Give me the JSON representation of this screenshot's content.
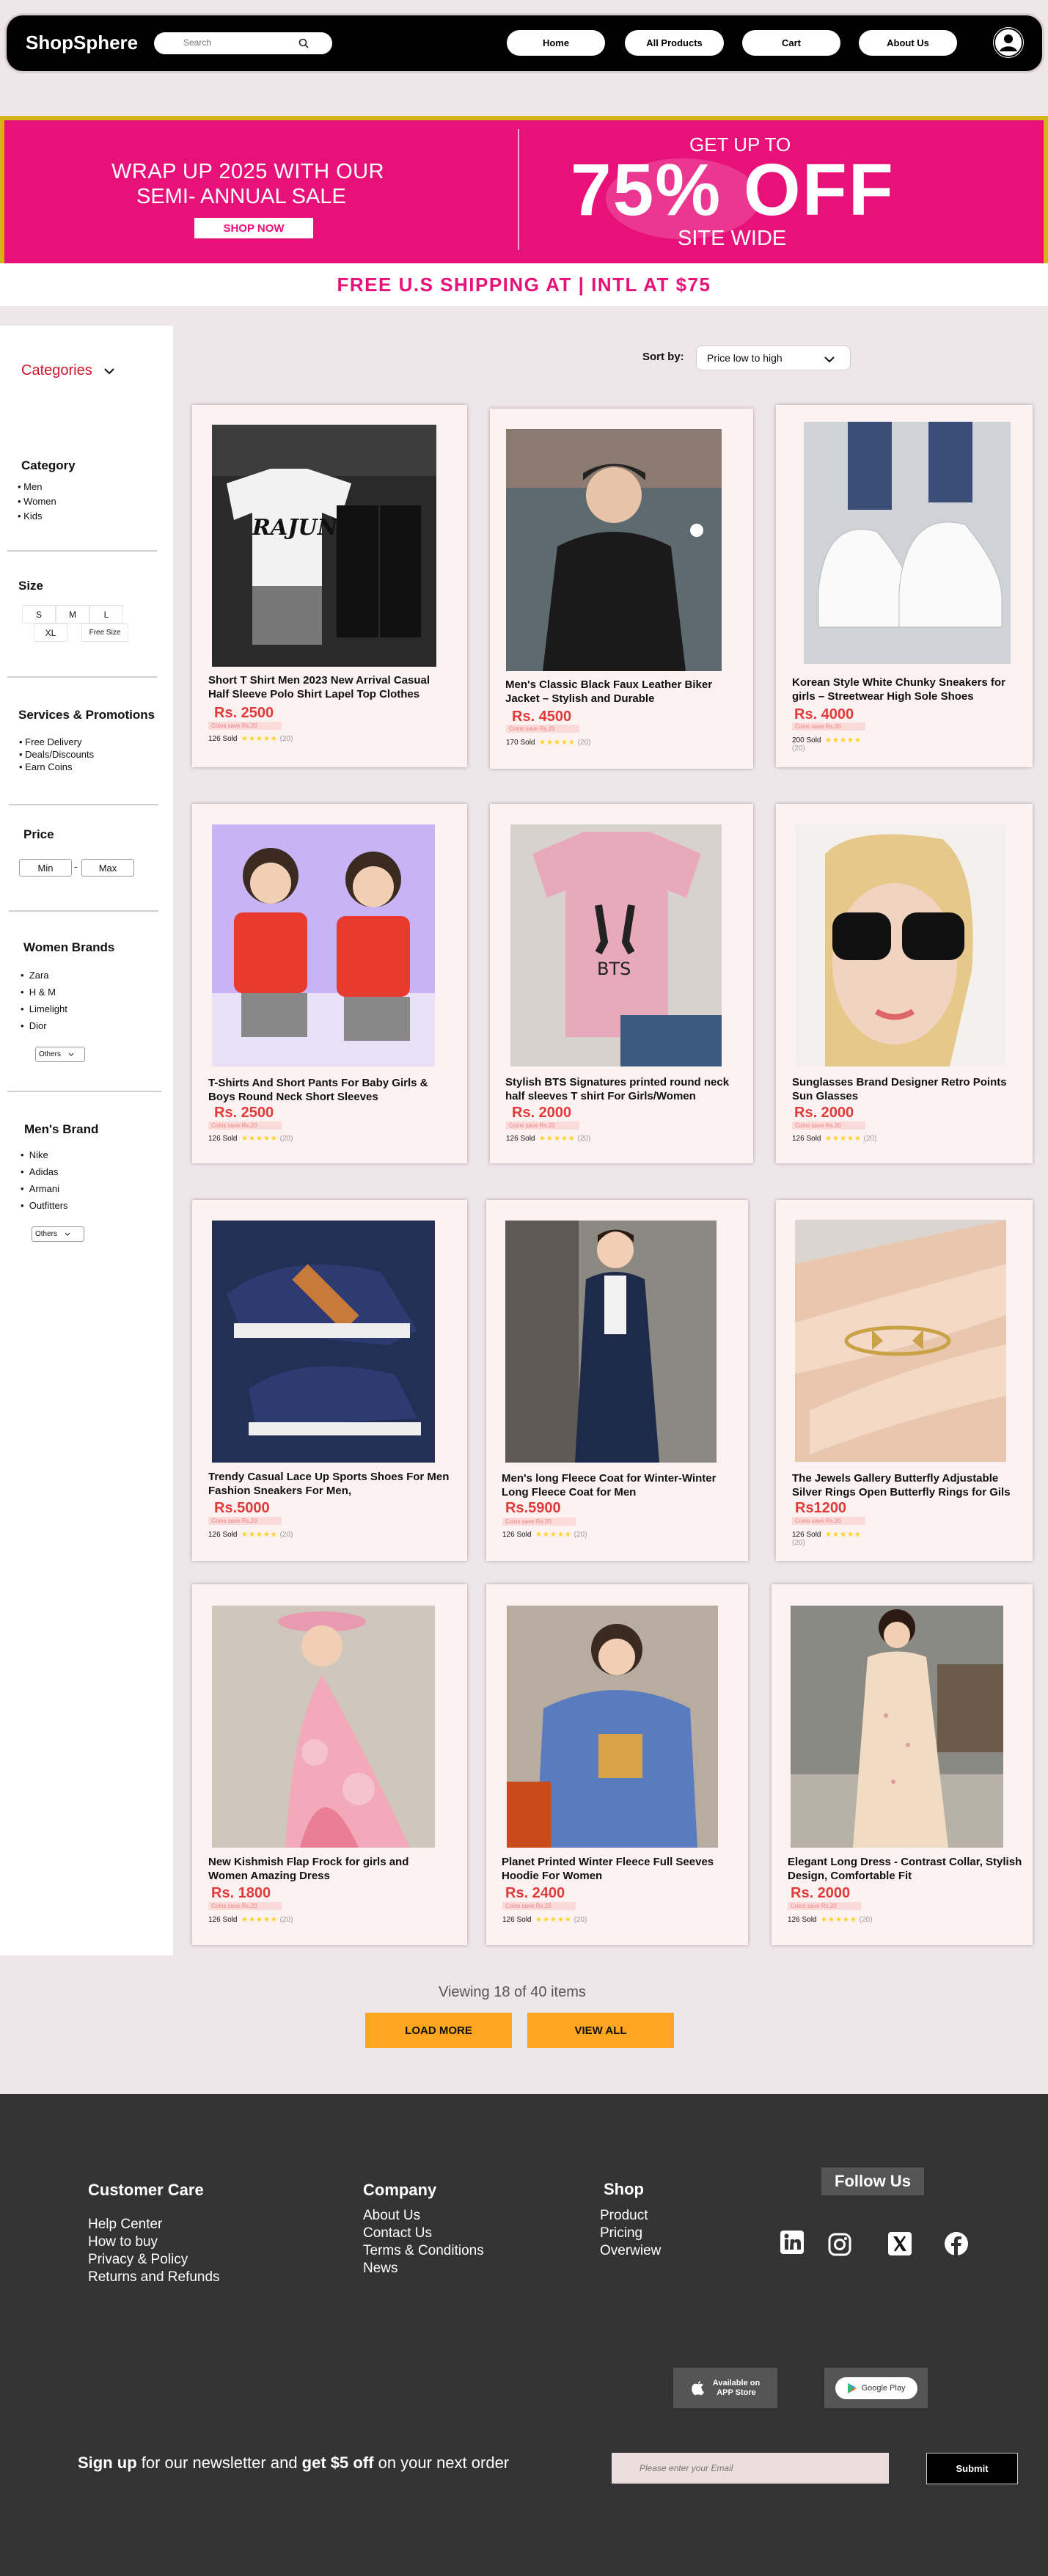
{
  "header": {
    "logo": "ShopSphere",
    "search_placeholder": "Search",
    "nav": [
      "Home",
      "All Products",
      "Cart",
      "About Us"
    ]
  },
  "banner": {
    "line1": "WRAP UP 2025 WITH OUR",
    "line2": "SEMI- ANNUAL SALE",
    "shop_now": "SHOP NOW",
    "get_up_to": "GET UP TO",
    "discount": "75%  OFF",
    "site_wide": "SITE WIDE"
  },
  "shipping": "FREE U.S SHIPPING AT  |  INTL  AT  $75",
  "sidebar": {
    "categories_title": "Categories",
    "category": {
      "title": "Category",
      "items": [
        "Men",
        "Women",
        "Kids"
      ]
    },
    "size": {
      "title": "Size",
      "options": [
        "S",
        "M",
        "L",
        "XL",
        "Free Size"
      ]
    },
    "services": {
      "title": "Services & Promotions",
      "items": [
        "Free Delivery",
        "Deals/Discounts",
        "Earn Coins"
      ]
    },
    "price": {
      "title": "Price",
      "min": "Min",
      "max": "Max",
      "separator": "-"
    },
    "women_brands": {
      "title": "Women Brands",
      "items": [
        "Zara",
        "H & M",
        "Limelight",
        "Dior"
      ],
      "others": "Others"
    },
    "men_brands": {
      "title": "Men's Brand",
      "items": [
        "Nike",
        "Adidas",
        "Armani",
        "Outfitters"
      ],
      "others": "Others"
    }
  },
  "sort": {
    "label": "Sort by:",
    "value": "Price low to high"
  },
  "products": [
    {
      "title": "Short T Shirt Men 2023 New Arrival Casual Half Sleeve Polo Shirt Lapel Top Clothes",
      "price": "Rs. 2500",
      "save": "Coins save Rs.20",
      "sold": "126 Sold",
      "reviews": "(20)"
    },
    {
      "title": "Men's Classic Black Faux Leather Biker Jacket – Stylish and Durable",
      "price": "Rs. 4500",
      "save": "Coins save Rs.20",
      "sold": "170 Sold",
      "reviews": "(20)"
    },
    {
      "title": "Korean Style White Chunky Sneakers for girls – Streetwear High Sole Shoes",
      "price": "Rs. 4000",
      "save": "Coins save Rs.20",
      "sold": "200 Sold",
      "reviews": "(20)"
    },
    {
      "title": "T-Shirts And Short Pants For Baby Girls & Boys Round Neck Short Sleeves",
      "price": "Rs. 2500",
      "save": "Coins save Rs.20",
      "sold": "126 Sold",
      "reviews": "(20)"
    },
    {
      "title": "Stylish BTS Signatures printed round neck half sleeves T shirt For Girls/Women",
      "price": "Rs. 2000",
      "save": "Coins save Rs.20",
      "sold": "126 Sold",
      "reviews": "(20)"
    },
    {
      "title": "Sunglasses Brand Designer Retro Points Sun Glasses",
      "price": "Rs. 2000",
      "save": "Coins save Rs.20",
      "sold": "126 Sold",
      "reviews": "(20)"
    },
    {
      "title": "Trendy Casual Lace Up Sports Shoes For Men Fashion Sneakers For Men,",
      "price": "Rs.5000",
      "save": "Coins save Rs.20",
      "sold": "126 Sold",
      "reviews": "(20)"
    },
    {
      "title": "Men's long Fleece Coat for Winter-Winter Long Fleece Coat for Men",
      "price": "Rs.5900",
      "save": "Coins save Rs.20",
      "sold": "126 Sold",
      "reviews": "(20)"
    },
    {
      "title": "The Jewels Gallery Butterfly Adjustable Silver Rings Open Butterfly Rings for Gils",
      "price": "Rs1200",
      "save": "Coins save Rs.20",
      "sold": "126 Sold",
      "reviews": "(20)"
    },
    {
      "title": "New Kishmish Flap Frock for girls and Women Amazing Dress",
      "price": "Rs. 1800",
      "save": "Coins save Rs.20",
      "sold": "126 Sold",
      "reviews": "(20)"
    },
    {
      "title": "Planet Printed Winter Fleece Full Seeves Hoodie For Women",
      "price": "Rs. 2400",
      "save": "Coins save Rs.20",
      "sold": "126 Sold",
      "reviews": "(20)"
    },
    {
      "title": "Elegant Long Dress - Contrast Collar, Stylish Design, Comfortable Fit",
      "price": "Rs. 2000",
      "save": "Coins save Rs.20",
      "sold": "126 Sold",
      "reviews": "(20)"
    }
  ],
  "pagination": {
    "viewing": "Viewing 18 of 40 items",
    "load_more": "LOAD MORE",
    "view_all": "VIEW ALL"
  },
  "footer": {
    "customer_care": {
      "title": "Customer Care",
      "links": [
        "Help Center",
        "How to buy",
        "Privacy & Policy",
        "Returns and Refunds"
      ]
    },
    "company": {
      "title": "Company",
      "links": [
        "About Us",
        "Contact Us",
        "Terms & Conditions",
        "News"
      ]
    },
    "shop": {
      "title": "Shop",
      "links": [
        "Product",
        "Pricing",
        "Overwiew"
      ]
    },
    "follow_us": "Follow Us",
    "app_store": {
      "small": "Available on",
      "big": "APP Store"
    },
    "google_play": "Google Play",
    "newsletter": {
      "b1": "Sign up",
      "t1": " for our newsletter and ",
      "b2": "get $5 off",
      "t2": " on your next order"
    },
    "email_placeholder": "Please enter your Email",
    "submit": "Submit"
  },
  "colors": {
    "brand_pink": "#e8117a",
    "gold_border": "#d4b416",
    "price_red": "#e03a3a",
    "button_orange": "#ffa51f",
    "footer_bg": "#333333"
  }
}
